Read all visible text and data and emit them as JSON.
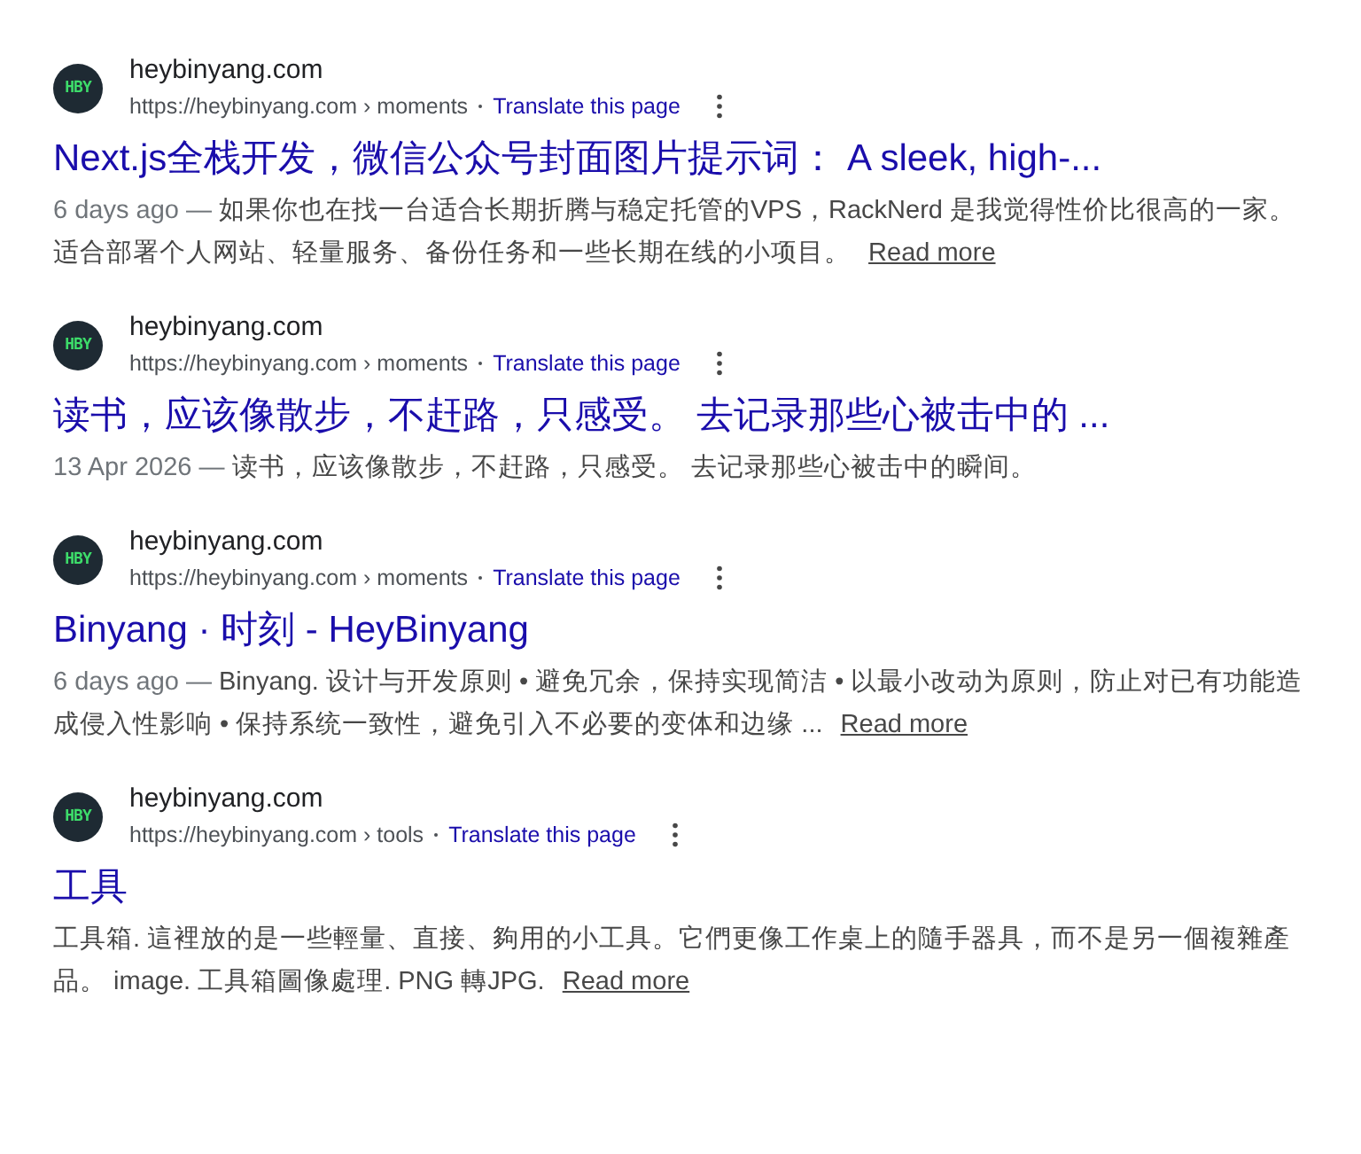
{
  "results": [
    {
      "favicon_text": "HBY",
      "site_name": "heybinyang.com",
      "url": "https://heybinyang.com › moments",
      "translate": "Translate this page",
      "title": "Next.js全栈开发，微信公众号封面图片提示词： A sleek, high-...",
      "date": "6 days ago —",
      "snippet": "如果你也在找一台适合长期折腾与稳定托管的VPS，RackNerd 是我觉得性价比很高的一家。适合部署个人网站、轻量服务、备份任务和一些长期在线的小项目。",
      "read_more": "Read more"
    },
    {
      "favicon_text": "HBY",
      "site_name": "heybinyang.com",
      "url": "https://heybinyang.com › moments",
      "translate": "Translate this page",
      "title": "读书，应该像散步，不赶路，只感受。 去记录那些心被击中的 ...",
      "date": "13 Apr 2026 —",
      "snippet": "读书，应该像散步，不赶路，只感受。 去记录那些心被击中的瞬间。"
    },
    {
      "favicon_text": "HBY",
      "site_name": "heybinyang.com",
      "url": "https://heybinyang.com › moments",
      "translate": "Translate this page",
      "title": "Binyang · 时刻 - HeyBinyang",
      "date": "6 days ago —",
      "snippet": "Binyang. 设计与开发原则 • 避免冗余，保持实现简洁 • 以最小改动为原则，防止对已有功能造成侵入性影响 • 保持系统一致性，避免引入不必要的变体和边缘 ...",
      "read_more": "Read more"
    },
    {
      "favicon_text": "HBY",
      "site_name": "heybinyang.com",
      "url": "https://heybinyang.com › tools",
      "translate": "Translate this page",
      "title": "工具",
      "snippet": "工具箱. 這裡放的是一些輕量、直接、夠用的小工具。它們更像工作桌上的隨手器具，而不是另一個複雜產品。 image. 工具箱圖像處理. PNG 轉JPG.",
      "read_more": "Read more"
    }
  ]
}
